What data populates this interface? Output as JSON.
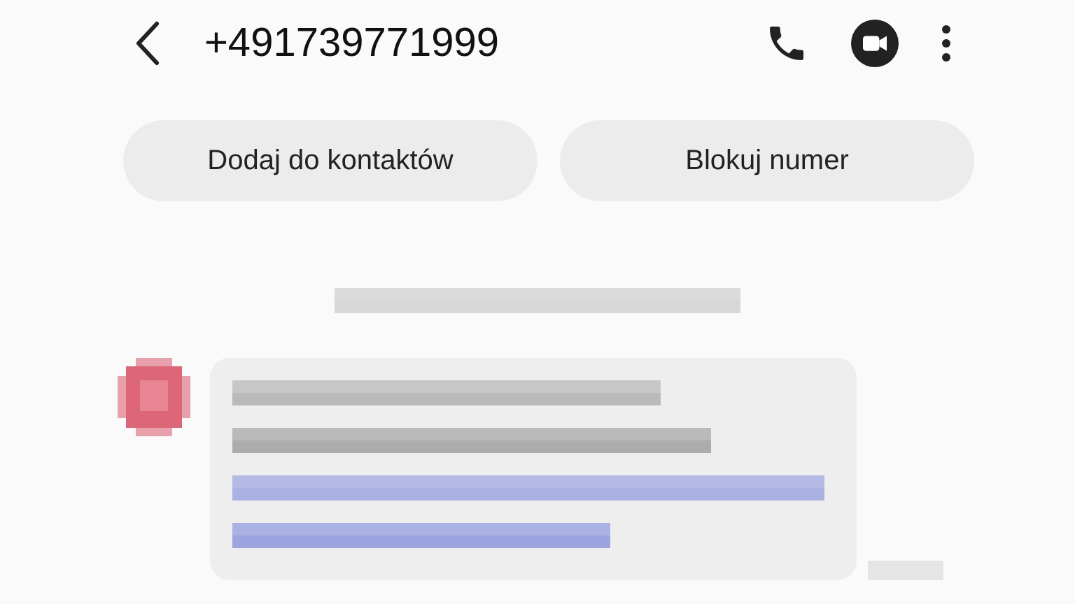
{
  "header": {
    "title": "+491739771999"
  },
  "actions": [
    "Dodaj do kontaktów",
    "Blokuj numer"
  ]
}
